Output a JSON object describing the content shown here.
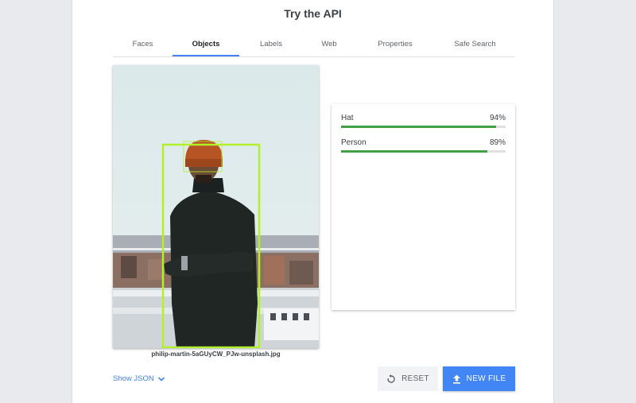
{
  "header": {
    "title": "Try the API"
  },
  "tabs": [
    {
      "label": "Faces"
    },
    {
      "label": "Objects"
    },
    {
      "label": "Labels"
    },
    {
      "label": "Web"
    },
    {
      "label": "Properties"
    },
    {
      "label": "Safe Search"
    }
  ],
  "active_tab": "Objects",
  "image": {
    "filename": "philip-martin-5aGUyCW_PJw-unsplash.jpg"
  },
  "results": [
    {
      "label": "Hat",
      "percent": "94%",
      "score": 0.94
    },
    {
      "label": "Person",
      "percent": "89%",
      "score": 0.89
    }
  ],
  "footer": {
    "show_json_label": "Show JSON",
    "reset_label": "RESET",
    "new_file_label": "NEW FILE"
  },
  "colors": {
    "accent": "#4285f4",
    "bar_fill": "#43a047",
    "bounding_box": "#b2f02a"
  },
  "icons": {
    "show_json": "chevron-down-icon",
    "reset": "reset-icon",
    "new_file": "upload-icon"
  }
}
